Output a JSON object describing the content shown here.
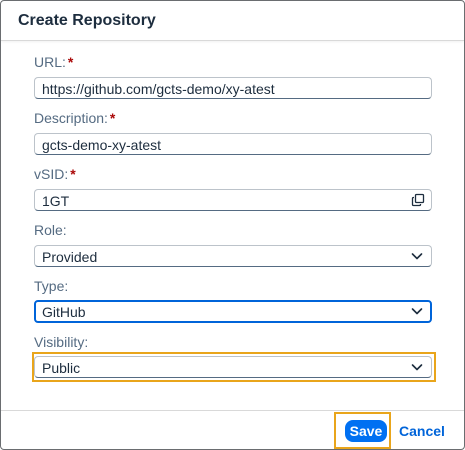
{
  "dialog": {
    "title": "Create Repository"
  },
  "form": {
    "url": {
      "label": "URL:",
      "required_mark": "*",
      "value": "https://github.com/gcts-demo/xy-atest"
    },
    "description": {
      "label": "Description:",
      "required_mark": "*",
      "value": "gcts-demo-xy-atest"
    },
    "vsid": {
      "label": "vSID:",
      "required_mark": "*",
      "value": "1GT",
      "icon": "copy-icon"
    },
    "role": {
      "label": "Role:",
      "value": "Provided",
      "icon": "chevron-down-icon"
    },
    "type": {
      "label": "Type:",
      "value": "GitHub",
      "icon": "chevron-down-icon"
    },
    "visibility": {
      "label": "Visibility:",
      "value": "Public",
      "icon": "chevron-down-icon"
    }
  },
  "footer": {
    "save_label": "Save",
    "cancel_label": "Cancel"
  },
  "colors": {
    "accent": "#0070f2",
    "required": "#aa0808",
    "highlight": "#e9a51b",
    "label": "#556b82"
  }
}
